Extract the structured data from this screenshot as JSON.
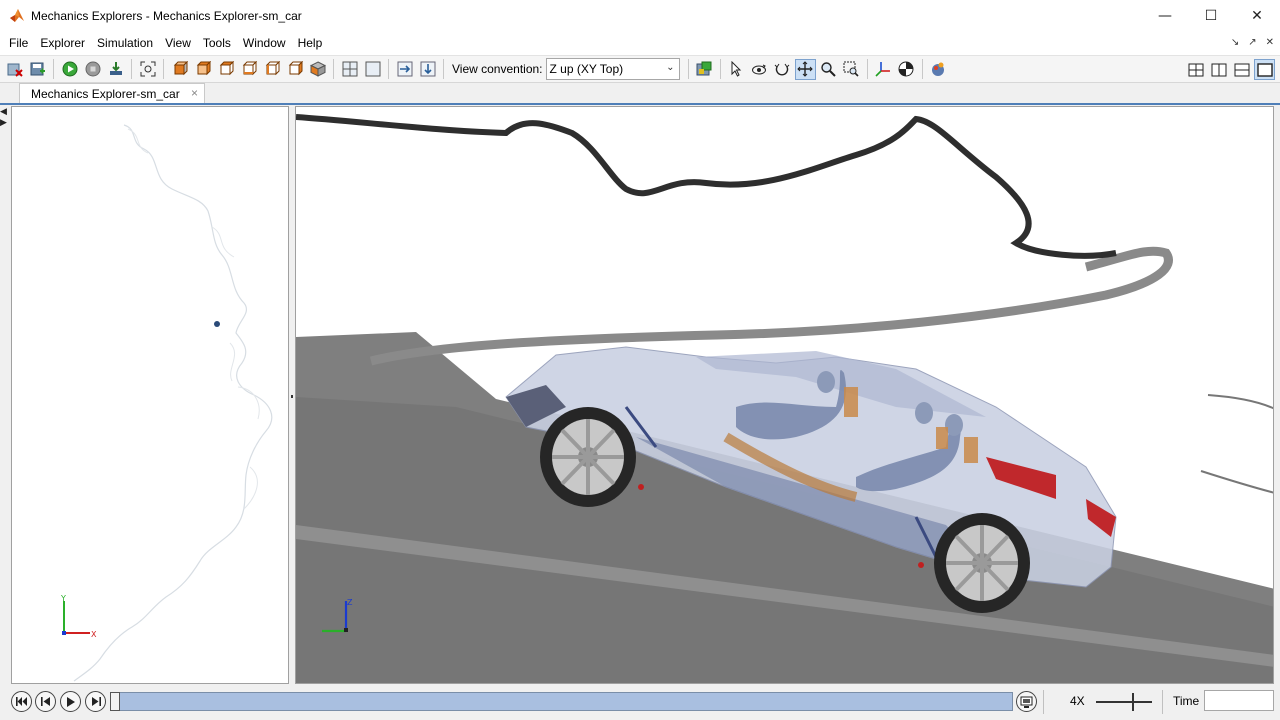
{
  "window": {
    "title": "Mechanics Explorers - Mechanics Explorer-sm_car",
    "minimize": "—",
    "maximize": "☐",
    "close": "✕"
  },
  "menu": {
    "items": [
      "File",
      "Explorer",
      "Simulation",
      "View",
      "Tools",
      "Window",
      "Help"
    ]
  },
  "toolbar": {
    "view_convention_label": "View convention:",
    "view_convention_value": "Z up (XY Top)"
  },
  "tabs": {
    "active": "Mechanics Explorer-sm_car",
    "close": "×"
  },
  "left_view": {
    "axis_y": "Y",
    "axis_x": "X"
  },
  "main_view": {
    "axis_z": "Z"
  },
  "playback": {
    "speed": "4X",
    "time_label": "Time",
    "time_value": "",
    "progress": 0
  },
  "icons": {
    "app": "matlab-logo-icon",
    "colors": {
      "accent": "#4f7fb8",
      "timeline": "#a9bfe0",
      "active_tool": "#cce0f5"
    }
  }
}
